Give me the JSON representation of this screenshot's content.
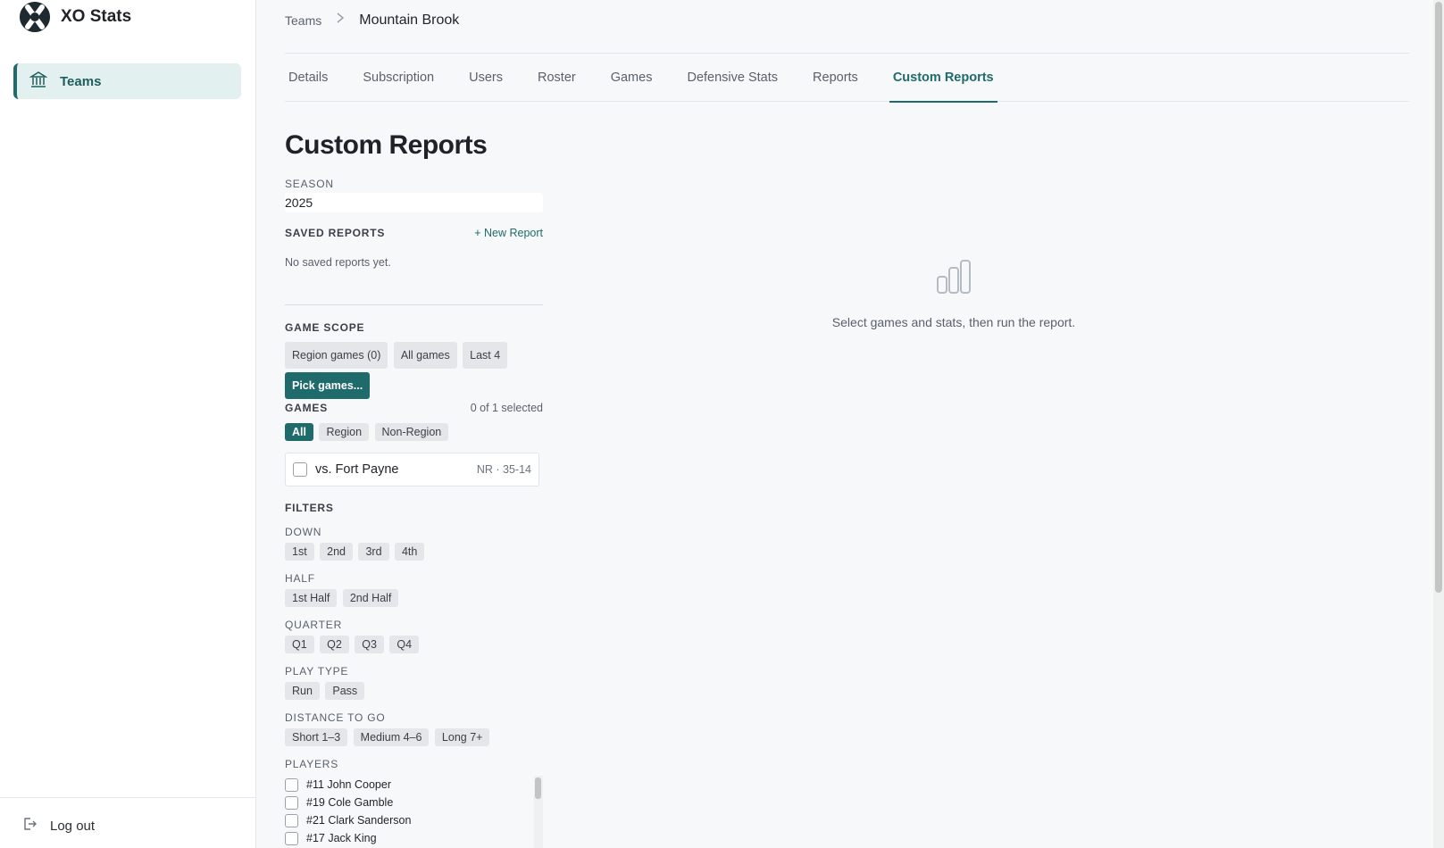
{
  "app": {
    "title": "XO Stats"
  },
  "sidebar": {
    "items": [
      {
        "label": "Teams",
        "icon": "bank-icon",
        "active": true
      }
    ],
    "logout_label": "Log out"
  },
  "breadcrumb": {
    "root": "Teams",
    "current": "Mountain Brook"
  },
  "tabs": [
    {
      "label": "Details"
    },
    {
      "label": "Subscription"
    },
    {
      "label": "Users"
    },
    {
      "label": "Roster"
    },
    {
      "label": "Games"
    },
    {
      "label": "Defensive Stats"
    },
    {
      "label": "Reports"
    },
    {
      "label": "Custom Reports",
      "active": true
    }
  ],
  "page": {
    "title": "Custom Reports"
  },
  "season": {
    "label": "SEASON",
    "value": "2025"
  },
  "saved_reports": {
    "label": "SAVED REPORTS",
    "new_label": "+ New Report",
    "empty_text": "No saved reports yet."
  },
  "game_scope": {
    "label": "GAME SCOPE",
    "options": [
      "Region games (0)",
      "All games",
      "Last 4",
      "Pick games..."
    ],
    "active": "Pick games..."
  },
  "games": {
    "label": "GAMES",
    "count": "0 of 1 selected",
    "filter_options": [
      "All",
      "Region",
      "Non-Region"
    ],
    "active_filter": "All",
    "list": [
      {
        "name": "vs. Fort Payne",
        "meta": "NR · 35-14"
      }
    ]
  },
  "filters": {
    "label": "FILTERS",
    "down": {
      "label": "DOWN",
      "options": [
        "1st",
        "2nd",
        "3rd",
        "4th"
      ]
    },
    "half": {
      "label": "HALF",
      "options": [
        "1st Half",
        "2nd Half"
      ]
    },
    "quarter": {
      "label": "QUARTER",
      "options": [
        "Q1",
        "Q2",
        "Q3",
        "Q4"
      ]
    },
    "play_type": {
      "label": "PLAY TYPE",
      "options": [
        "Run",
        "Pass"
      ]
    },
    "distance": {
      "label": "DISTANCE TO GO",
      "options": [
        "Short 1–3",
        "Medium 4–6",
        "Long 7+"
      ]
    }
  },
  "players": {
    "label": "PLAYERS",
    "list": [
      "#11 John Cooper",
      "#19 Cole Gamble",
      "#21 Clark Sanderson",
      "#17 Jack King"
    ]
  },
  "empty_state": {
    "icon": "bar-chart-icon",
    "text": "Select games and stats, then run the report."
  },
  "colors": {
    "accent": "#1f6b6b",
    "accent_light": "#e2f0f0"
  }
}
